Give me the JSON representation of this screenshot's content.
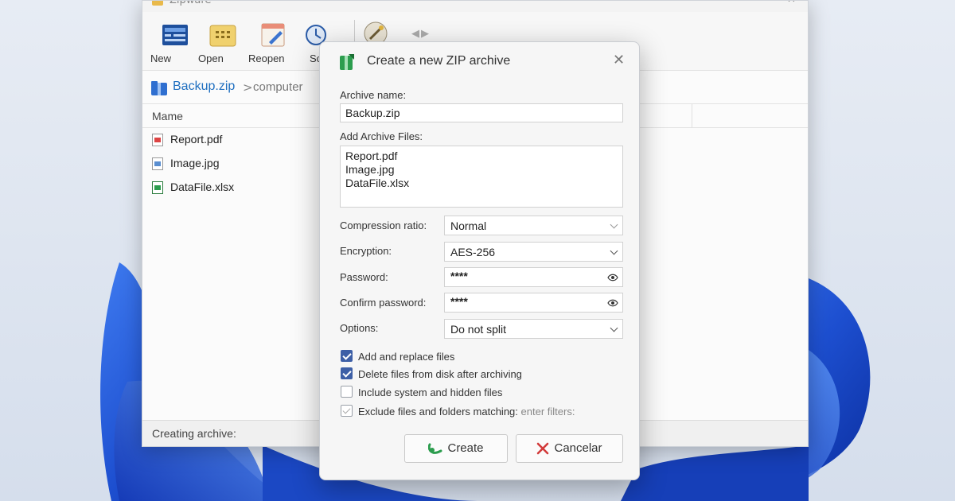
{
  "app": {
    "title": "Zipware",
    "window_controls": {
      "minimize": "—",
      "close": "✕"
    }
  },
  "toolbar": {
    "buttons": [
      {
        "label": "New",
        "icon": "new-archive-icon"
      },
      {
        "label": "Open",
        "icon": "open-archive-icon"
      },
      {
        "label": "Reopen",
        "icon": "reopen-archive-icon"
      },
      {
        "label": "Sc",
        "icon": "scan-icon"
      }
    ],
    "nav_arrows": "◀▶"
  },
  "breadcrumb": {
    "archive": "Backup.zip",
    "separator": ">",
    "location": "computer"
  },
  "file_list": {
    "column_name": "Mame",
    "files": [
      {
        "name": "Report.pdf",
        "type": "pdf"
      },
      {
        "name": "Image.jpg",
        "type": "img"
      },
      {
        "name": "DataFile.xlsx",
        "type": "xls"
      }
    ]
  },
  "status": {
    "text": "Creating archive:"
  },
  "dialog": {
    "title": "Create a new ZIP archive",
    "close": "✕",
    "archive_name_label": "Archive name:",
    "archive_name_value": "Backup.zip",
    "add_files_label": "Add Archive Files:",
    "files": [
      "Report.pdf",
      "Image.jpg",
      "DataFile.xlsx"
    ],
    "compression_label": "Compression ratio:",
    "compression_value": "Normal",
    "encryption_label": "Encryption:",
    "encryption_value": "AES-256",
    "password_label": "Password:",
    "password_value": "****",
    "confirm_label": "Confirm password:",
    "confirm_value": "****",
    "options_label": "Options:",
    "options_value": "Do not split",
    "checkboxes": [
      {
        "label": "Add and replace files",
        "checked": true
      },
      {
        "label": "Delete files from disk after archiving",
        "checked": true
      },
      {
        "label": "Include system and hidden files",
        "checked": false
      },
      {
        "label": "Exclude files and folders matching:",
        "hint": "enter filters:",
        "checked": false
      }
    ],
    "create_label": "Create",
    "cancel_label": "Cancelar"
  },
  "colors": {
    "accent": "#3d5fa6",
    "link": "#1f6fc0",
    "create_icon": "#2c9d4e",
    "cancel_icon": "#d23b3b",
    "wallpaper_blue": "#1f55c9"
  }
}
